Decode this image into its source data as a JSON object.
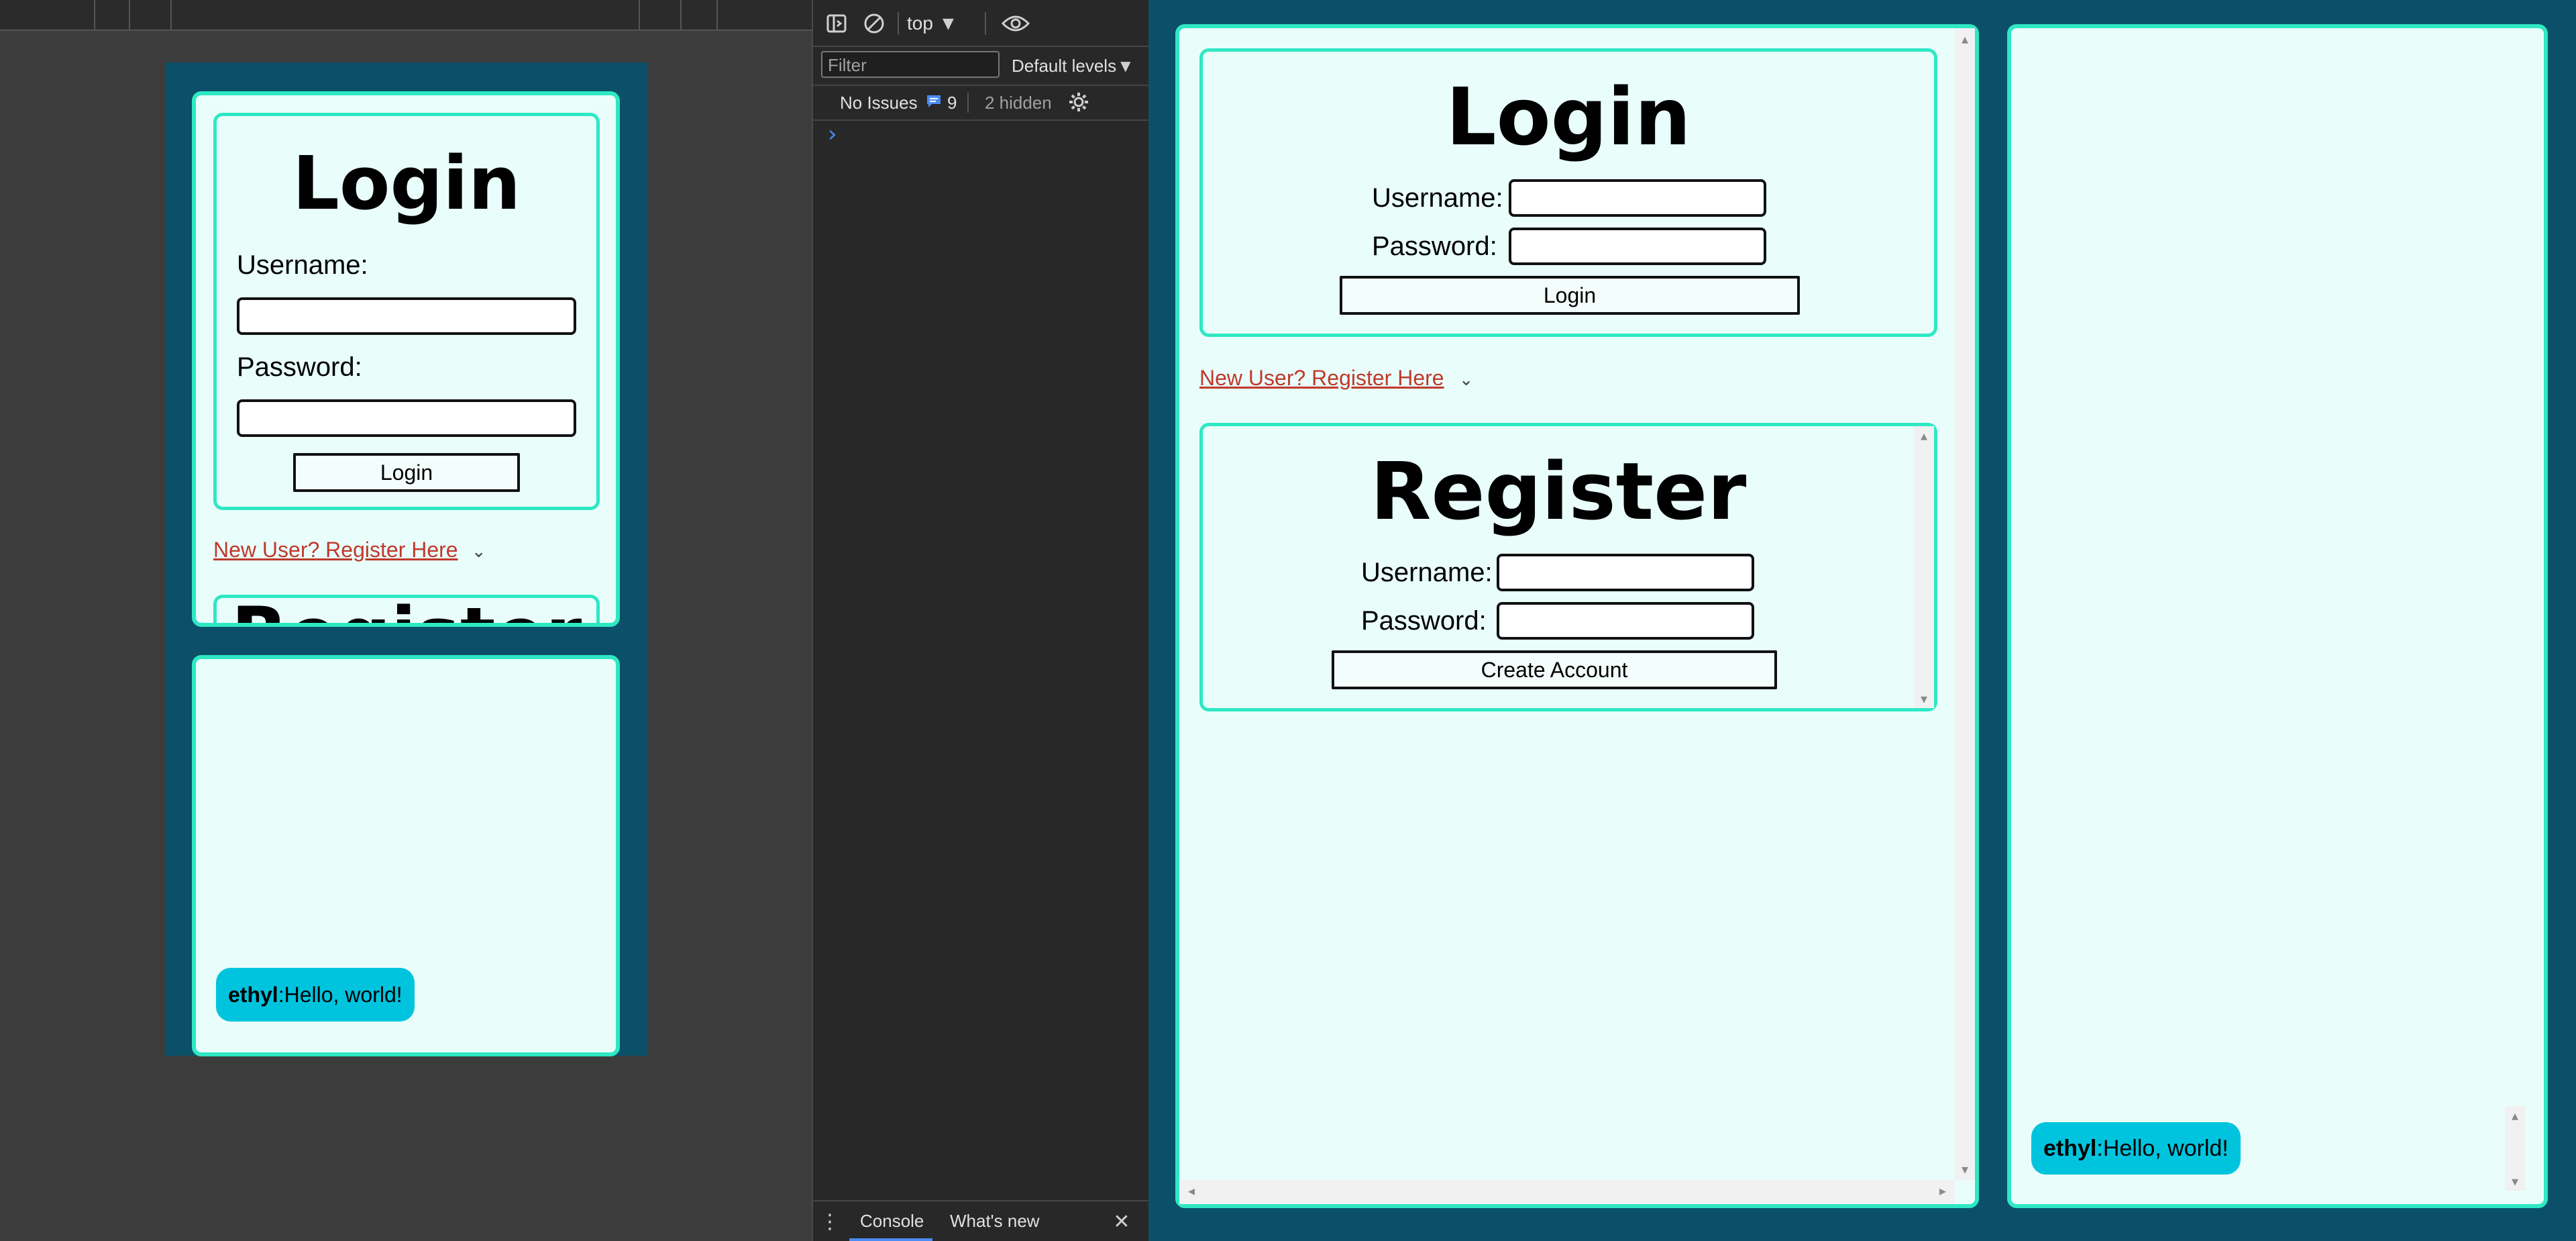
{
  "login": {
    "title": "Login",
    "username_label": "Username:",
    "password_label": "Password:",
    "button": "Login"
  },
  "register_toggle": {
    "link": "New User? Register Here",
    "chevron": "⌄"
  },
  "register": {
    "title": "Register",
    "username_label": "Username:",
    "password_label": "Password:",
    "button": "Create Account"
  },
  "mobile_register_peek": "Register",
  "chat": {
    "messages": [
      {
        "user": "ethyl",
        "separator": ": ",
        "text": "Hello, world!"
      }
    ]
  },
  "devtools": {
    "context": "top",
    "filter_placeholder": "Filter",
    "levels": "Default levels",
    "issues": "No Issues",
    "message_count": "9",
    "hidden": "2 hidden",
    "prompt": "›",
    "tabs": [
      "Console",
      "What's new"
    ],
    "close": "✕",
    "more": "⋮"
  },
  "colors": {
    "page_bg": "#0b4f68",
    "panel_border": "#2ee8c4",
    "panel_fill": "#e9fefb",
    "bubble": "#00c4de",
    "link": "#c0392b",
    "devtools_bg": "#282828"
  }
}
